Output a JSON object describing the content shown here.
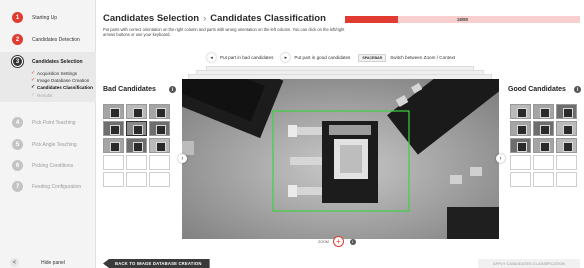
{
  "sidebar": {
    "steps": [
      {
        "num": "1",
        "label": "Starting Up"
      },
      {
        "num": "2",
        "label": "Candidates Detection"
      },
      {
        "num": "3",
        "label": "Candidates Selection"
      },
      {
        "num": "4",
        "label": "Pick Point Teaching"
      },
      {
        "num": "5",
        "label": "Pick Angle Teaching"
      },
      {
        "num": "6",
        "label": "Picking Conditions"
      },
      {
        "num": "7",
        "label": "Feeding Configuration"
      }
    ],
    "substeps": [
      {
        "check": "✓",
        "label": "Acquisition Settings"
      },
      {
        "check": "✓",
        "label": "Image Database Creation"
      },
      {
        "check": "✓",
        "label": "Candidates Classification"
      },
      {
        "check": "✓",
        "label": "Results"
      }
    ],
    "hide_panel": {
      "icon": "<",
      "label": "Hide panel"
    }
  },
  "header": {
    "breadcrumb_parent": "Candidates Selection",
    "breadcrumb_sep": "›",
    "breadcrumb_current": "Candidates Classification",
    "instructions": "Put parts with correct orientation on the right column and parts with wrong orientation on the left column. You can click on the left/right arrows buttons or use your keyboard.",
    "progress_text": "18/80",
    "progress_fraction": 0.225
  },
  "hints": {
    "bad": {
      "key": "◂",
      "label": "Put part in bad candidates"
    },
    "good": {
      "key": "▸",
      "label": "Put part in good candidates"
    },
    "zoom": {
      "key": "SPACEBAR",
      "label": "Switch between Zoom / Context"
    }
  },
  "bad_panel": {
    "title": "Bad Candidates",
    "info": "i"
  },
  "good_panel": {
    "title": "Good Candidates",
    "info": "i"
  },
  "nav": {
    "left": "‹",
    "right": "›"
  },
  "zoom": {
    "label": "ZOOM",
    "button": "+",
    "info": "i"
  },
  "footer": {
    "back": "BACK TO IMAGE DATABASE CREATION",
    "apply": "APPLY CANDIDATES CLASSIFICATION"
  },
  "colors": {
    "accent": "#e03c31",
    "selection_box": "#3fd13f"
  }
}
